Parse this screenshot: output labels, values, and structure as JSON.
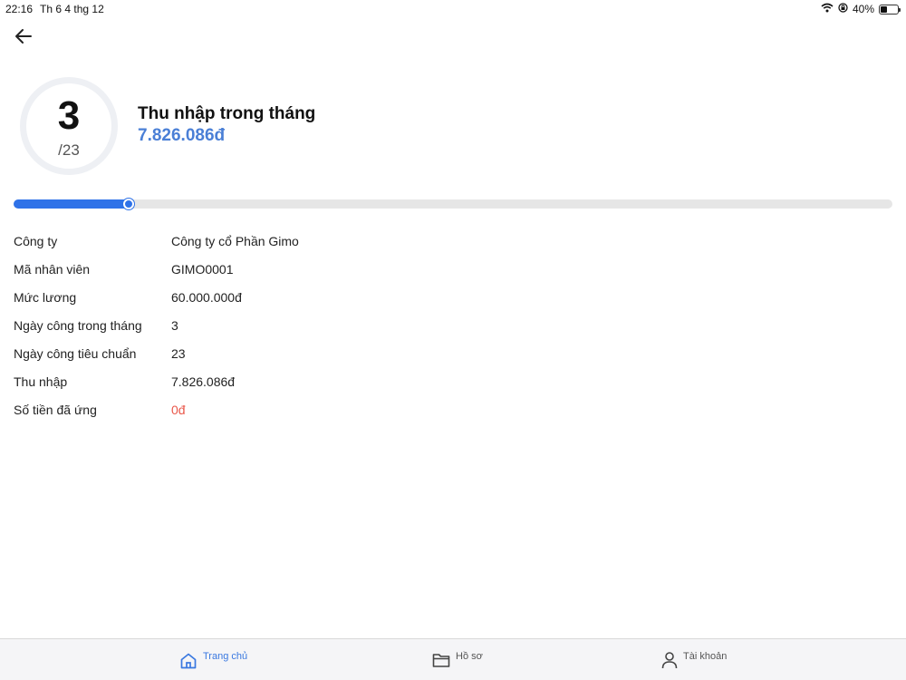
{
  "status_bar": {
    "time": "22:16",
    "date": "Th 6 4 thg 12",
    "battery_text": "40%",
    "battery_level": 0.4
  },
  "summary": {
    "days_worked": "3",
    "days_standard": "/23",
    "income_title": "Thu nhập trong tháng",
    "income_amount": "7.826.086đ"
  },
  "progress": {
    "value": 3,
    "max": 23
  },
  "info": [
    {
      "label": "Công ty",
      "value": "Công ty cổ Phần Gimo"
    },
    {
      "label": "Mã nhân viên",
      "value": "GIMO0001"
    },
    {
      "label": "Mức lương",
      "value": "60.000.000đ"
    },
    {
      "label": "Ngày công trong tháng",
      "value": "3"
    },
    {
      "label": "Ngày công tiêu chuẩn",
      "value": "23"
    },
    {
      "label": "Thu nhập",
      "value": "7.826.086đ"
    },
    {
      "label": "Số tiền đã ứng",
      "value": "0đ"
    }
  ],
  "bottom_nav": {
    "home": "Trang chủ",
    "profile": "Hồ sơ",
    "account": "Tài khoản"
  },
  "colors": {
    "accent": "#2f72e8",
    "income": "#4a7fd6",
    "negative": "#e9574a",
    "nav_active": "#3a78e0"
  },
  "icons": {
    "back": "arrow-left-icon",
    "home": "home-icon",
    "profile": "folder-icon",
    "account": "user-icon",
    "wifi": "wifi-icon",
    "lock": "rotation-lock-icon",
    "battery": "battery-icon"
  }
}
